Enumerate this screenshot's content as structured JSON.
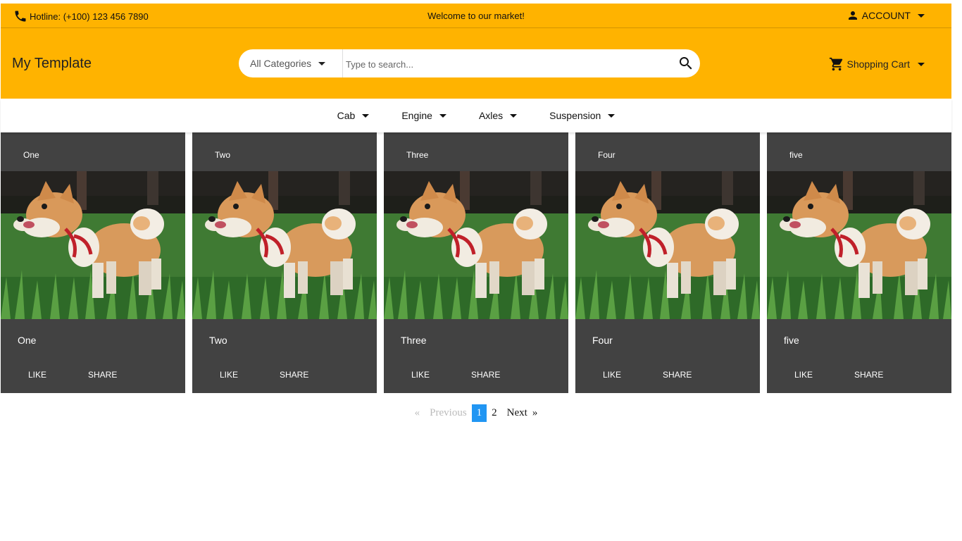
{
  "topbar": {
    "hotline": "Hotline: (+100) 123 456 7890",
    "welcome": "Welcome to our market!",
    "account": "ACCOUNT"
  },
  "header": {
    "brand": "My Template",
    "category": "All Categories",
    "search_placeholder": "Type to search...",
    "cart": "Shopping Cart"
  },
  "nav": {
    "items": [
      {
        "label": "Cab"
      },
      {
        "label": "Engine"
      },
      {
        "label": "Axles"
      },
      {
        "label": "Suspension"
      }
    ]
  },
  "cards": [
    {
      "head": "One",
      "title": "One",
      "like": "LIKE",
      "share": "SHARE"
    },
    {
      "head": "Two",
      "title": "Two",
      "like": "LIKE",
      "share": "SHARE"
    },
    {
      "head": "Three",
      "title": "Three",
      "like": "LIKE",
      "share": "SHARE"
    },
    {
      "head": "Four",
      "title": "Four",
      "like": "LIKE",
      "share": "SHARE"
    },
    {
      "head": "five",
      "title": "five",
      "like": "LIKE",
      "share": "SHARE"
    }
  ],
  "pagination": {
    "prev_arrow": "«",
    "prev": "Previous",
    "pages": [
      "1",
      "2"
    ],
    "next": "Next",
    "next_arrow": "»",
    "current": "1"
  },
  "colors": {
    "accent": "#FFB300",
    "card_bg": "#424242",
    "active_page": "#2196F3"
  },
  "icons": {
    "phone": "phone-icon",
    "account": "person-icon",
    "search": "search-icon",
    "cart": "cart-icon",
    "card_image": "dog-photo"
  }
}
